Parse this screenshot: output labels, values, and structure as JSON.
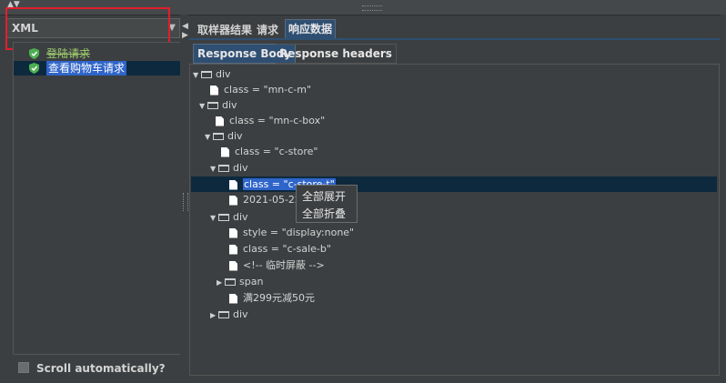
{
  "top_bar": {
    "collapse_arrows": "▲▼"
  },
  "left_panel": {
    "renderer_select": {
      "value": "XML",
      "arrow": "▼"
    },
    "tree_items": [
      {
        "label": "登陆请求",
        "icon": "shield-check-icon",
        "status_color": "#4caf50"
      },
      {
        "label": "查看购物车请求",
        "icon": "shield-check-icon",
        "status_color": "#4caf50",
        "selected": true
      }
    ],
    "scroll_checkbox": {
      "label": "Scroll automatically?",
      "checked": false
    }
  },
  "tabs": [
    {
      "label": "取样器结果",
      "active": false
    },
    {
      "label": "请求",
      "active": false
    },
    {
      "label": "响应数据",
      "active": true
    }
  ],
  "sub_tabs": [
    {
      "label": "Response Body",
      "active": true
    },
    {
      "label": "Response headers",
      "active": false
    }
  ],
  "response_tree": [
    {
      "type": "folder",
      "label": "div",
      "expanded": true
    },
    {
      "type": "file",
      "label": "class = \"mn-c-m\""
    },
    {
      "type": "folder",
      "label": "div",
      "expanded": true
    },
    {
      "type": "file",
      "label": "class = \"mn-c-box\""
    },
    {
      "type": "folder",
      "label": "div",
      "expanded": true
    },
    {
      "type": "file",
      "label": "class = \"c-store\""
    },
    {
      "type": "folder",
      "label": "div",
      "expanded": true
    },
    {
      "type": "file",
      "label": "class = \"c-store-t\"",
      "selected": true
    },
    {
      "type": "file",
      "label": "2021-05-22"
    },
    {
      "type": "folder",
      "label": "div",
      "expanded": true
    },
    {
      "type": "file",
      "label": "style = \"display:none\""
    },
    {
      "type": "file",
      "label": "class = \"c-sale-b\""
    },
    {
      "type": "file",
      "label": "<!-- 临时屏蔽 -->"
    },
    {
      "type": "folder",
      "label": "span",
      "expanded": false
    },
    {
      "type": "file",
      "label": "满299元减50元"
    },
    {
      "type": "folder",
      "label": "div",
      "expanded": false
    }
  ],
  "context_menu": {
    "items": [
      "全部展开",
      "全部折叠"
    ]
  },
  "colors": {
    "highlight_box": "#e21e2c",
    "selection": "#2f65ca",
    "active_tab": "#2f4f72"
  }
}
